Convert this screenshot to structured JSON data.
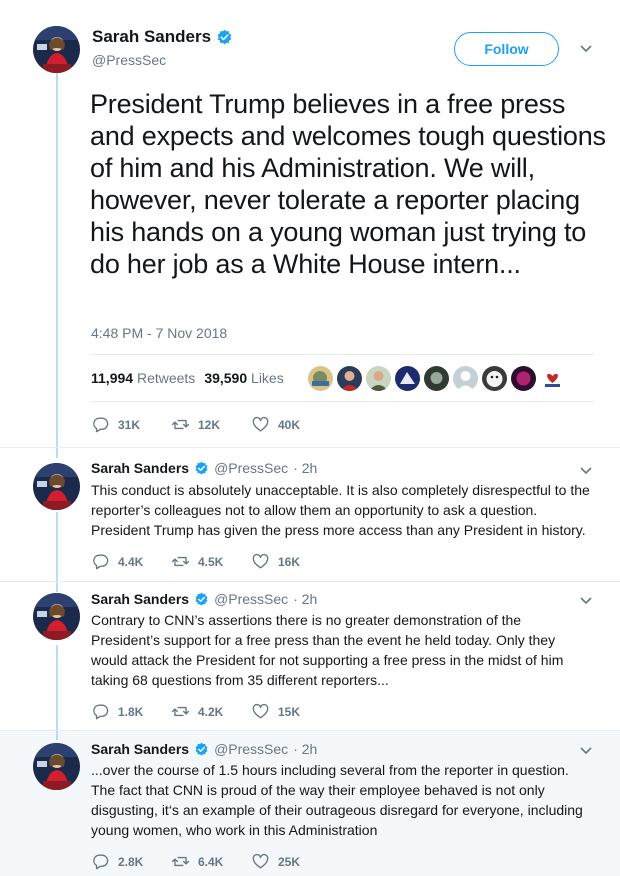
{
  "main_tweet": {
    "name": "Sarah Sanders",
    "handle": "@PressSec",
    "follow_label": "Follow",
    "text": "President Trump believes in a free press and expects and welcomes tough questions of him and his Administration. We will, however, never tolerate a reporter placing his hands on a young woman just trying to do her job as a White House intern...",
    "timestamp": "4:48 PM - 7 Nov 2018",
    "retweets_count": "11,994",
    "retweets_label": "Retweets",
    "likes_count": "39,590",
    "likes_label": "Likes",
    "reply_count": "31K",
    "retweet_count_short": "12K",
    "like_count_short": "40K"
  },
  "replies": [
    {
      "name": "Sarah Sanders",
      "handle": "@PressSec",
      "time": "· 2h",
      "text": "This conduct is absolutely unacceptable. It is also completely disrespectful to the reporter’s colleagues not to allow them an opportunity to ask a question. President Trump has given the press more access than any President in history.",
      "replies": "4.4K",
      "retweets": "4.5K",
      "likes": "16K"
    },
    {
      "name": "Sarah Sanders",
      "handle": "@PressSec",
      "time": "· 2h",
      "text": "Contrary to CNN’s assertions there is no greater demonstration of the President’s support for a free press than the event he held today. Only they would attack the President for not supporting a free press in the midst of him taking 68 questions from 35 different reporters...",
      "replies": "1.8K",
      "retweets": "4.2K",
      "likes": "15K"
    },
    {
      "name": "Sarah Sanders",
      "handle": "@PressSec",
      "time": "· 2h",
      "text": "...over the course of 1.5 hours including several from the reporter in question. The fact that CNN is proud of the way their employee behaved is not only disgusting, it‘s an example of their outrageous disregard for everyone, including young women, who work in this Administration",
      "replies": "2.8K",
      "retweets": "6.4K",
      "likes": "25K"
    }
  ],
  "colors": {
    "accent": "#1da1f2",
    "muted": "#657786",
    "thread_line": "#b8dcf5"
  }
}
